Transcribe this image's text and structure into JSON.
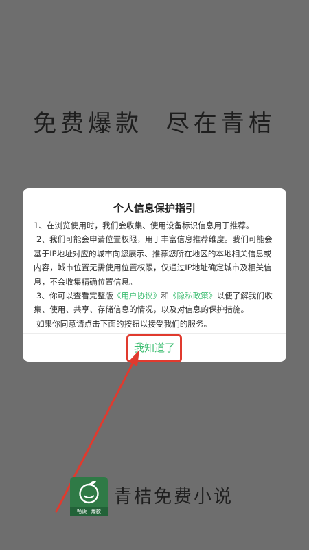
{
  "background": {
    "slogan": "免费爆款  尽在青桔",
    "brand": {
      "name": "青桔免费小说",
      "tagline": "畅读 · 爆款",
      "logo_icon": "tangerine-logo-icon"
    }
  },
  "dialog": {
    "title": "个人信息保护指引",
    "paragraph1": "1、在浏览使用时，我们会收集、使用设备标识信息用于推荐。",
    "paragraph2": "2、我们可能会申请位置权限，用于丰富信息推荐维度。我们可能会基于IP地址对应的城市向您展示、推荐您所在地区的本地相关信息或内容，城市位置无需使用位置权限，仅通过IP地址确定城市及相关信息，不会收集精确位置信息。",
    "paragraph3": {
      "prefix": "3、你可以查看完整版",
      "user_agreement_link": "《用户协议》",
      "and": "和",
      "privacy_policy_link": "《隐私政策》",
      "suffix": "以便了解我们收集、使用、共享、存储信息的情况，以及对信息的保护措施。"
    },
    "paragraph4": "如果你同意请点击下面的按钮以接受我们的服务。",
    "confirm_label": "我知道了"
  },
  "annotation": {
    "color": "#e03a2e"
  },
  "colors": {
    "accent": "#3bbd70",
    "overlay": "#6e6e6e",
    "logo_green": "#2f7a46"
  }
}
